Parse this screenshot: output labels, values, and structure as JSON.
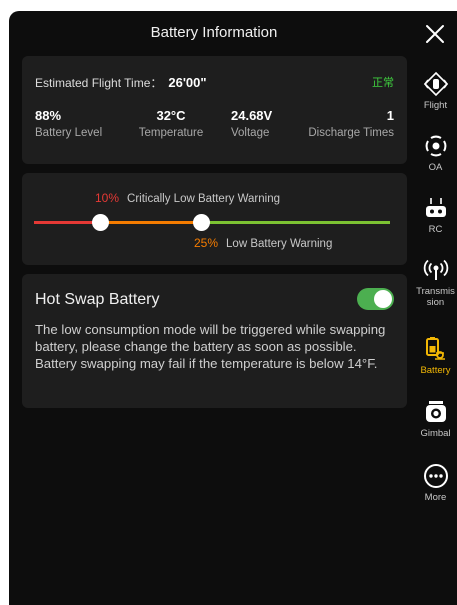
{
  "header": {
    "title": "Battery Information"
  },
  "summary": {
    "flight_time_label": "Estimated Flight Time：",
    "flight_time_value": "26'00\"",
    "status": "正常",
    "stats": [
      {
        "value": "88%",
        "label": "Battery Level"
      },
      {
        "value": "32°C",
        "label": "Temperature"
      },
      {
        "value": "24.68V",
        "label": "Voltage"
      },
      {
        "value": "1",
        "label": "Discharge Times"
      }
    ]
  },
  "warnings": {
    "critical": {
      "percent": "10%",
      "label": "Critically Low Battery Warning",
      "level": 10
    },
    "low": {
      "percent": "25%",
      "label": "Low Battery Warning",
      "level": 25
    }
  },
  "hot_swap": {
    "title": "Hot Swap Battery",
    "enabled": true,
    "description": "The low consumption mode will be triggered while swapping battery, please change the battery as soon as possible. Battery swapping may fail if the temperature is below 14°F."
  },
  "sidebar": {
    "items": [
      {
        "label": "Flight",
        "icon": "drone-flight-icon",
        "active": false
      },
      {
        "label": "OA",
        "icon": "obstacle-avoidance-icon",
        "active": false
      },
      {
        "label": "RC",
        "icon": "remote-controller-icon",
        "active": false
      },
      {
        "label": "Transmission",
        "icon": "transmission-icon",
        "active": false
      },
      {
        "label": "Battery",
        "icon": "battery-icon",
        "active": true
      },
      {
        "label": "Gimbal",
        "icon": "gimbal-camera-icon",
        "active": false
      },
      {
        "label": "More",
        "icon": "more-icon",
        "active": false
      }
    ]
  },
  "colors": {
    "accent_active": "#f2b705",
    "critical": "#e53935",
    "low": "#f57c00",
    "normal": "#7cc232",
    "toggle_on": "#4caf50",
    "status_ok": "#3fcf3f"
  }
}
